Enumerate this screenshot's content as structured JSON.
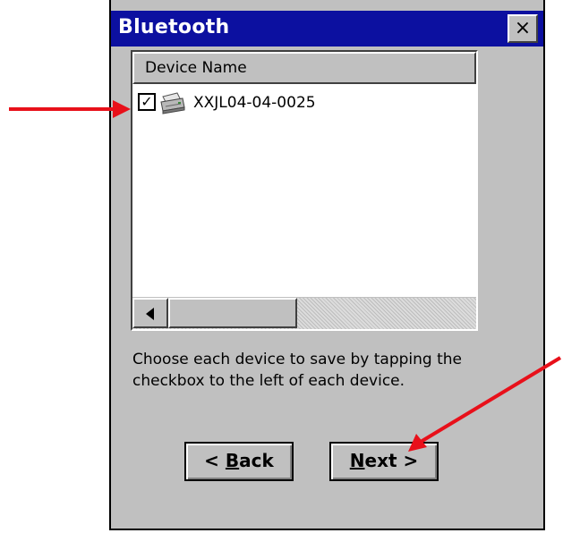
{
  "window": {
    "title": "Bluetooth",
    "close_label": "×"
  },
  "list": {
    "column_header": "Device Name",
    "items": [
      {
        "label": "XXJL04-04-0025",
        "checked": true,
        "check_glyph": "✓",
        "icon": "printer-icon"
      }
    ]
  },
  "instructions": "Choose each device to save by tapping the checkbox to the left of each device.",
  "buttons": {
    "back_label": "< Back",
    "next_label": "Next >"
  },
  "colors": {
    "titlebar": "#0c10a0",
    "annotation_arrow": "#e8101a",
    "dialog_face": "#c0c0c0"
  }
}
